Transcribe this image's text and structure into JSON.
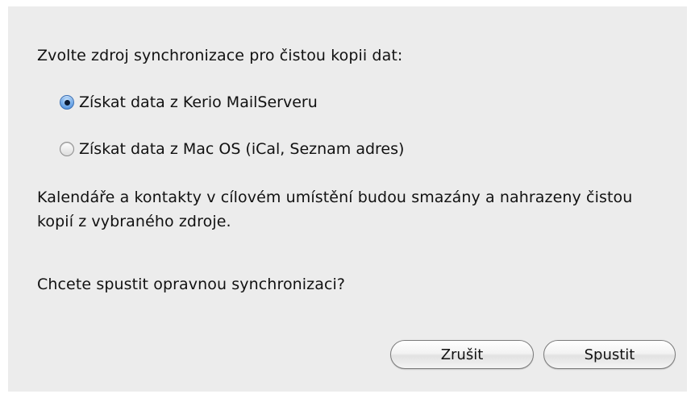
{
  "dialog": {
    "prompt": "Zvolte zdroj synchronizace pro čistou kopii dat:",
    "options": [
      {
        "label": "Získat data z Kerio MailServeru",
        "selected": true
      },
      {
        "label": "Získat data z Mac OS (iCal, Seznam adres)",
        "selected": false
      }
    ],
    "info": "Kalendáře a kontakty v cílovém umístění budou smazány a nahrazeny čistou kopií z vybraného zdroje.",
    "question": "Chcete spustit opravnou synchronizaci?",
    "buttons": {
      "cancel_label": "Zrušit",
      "run_label": "Spustit"
    }
  }
}
